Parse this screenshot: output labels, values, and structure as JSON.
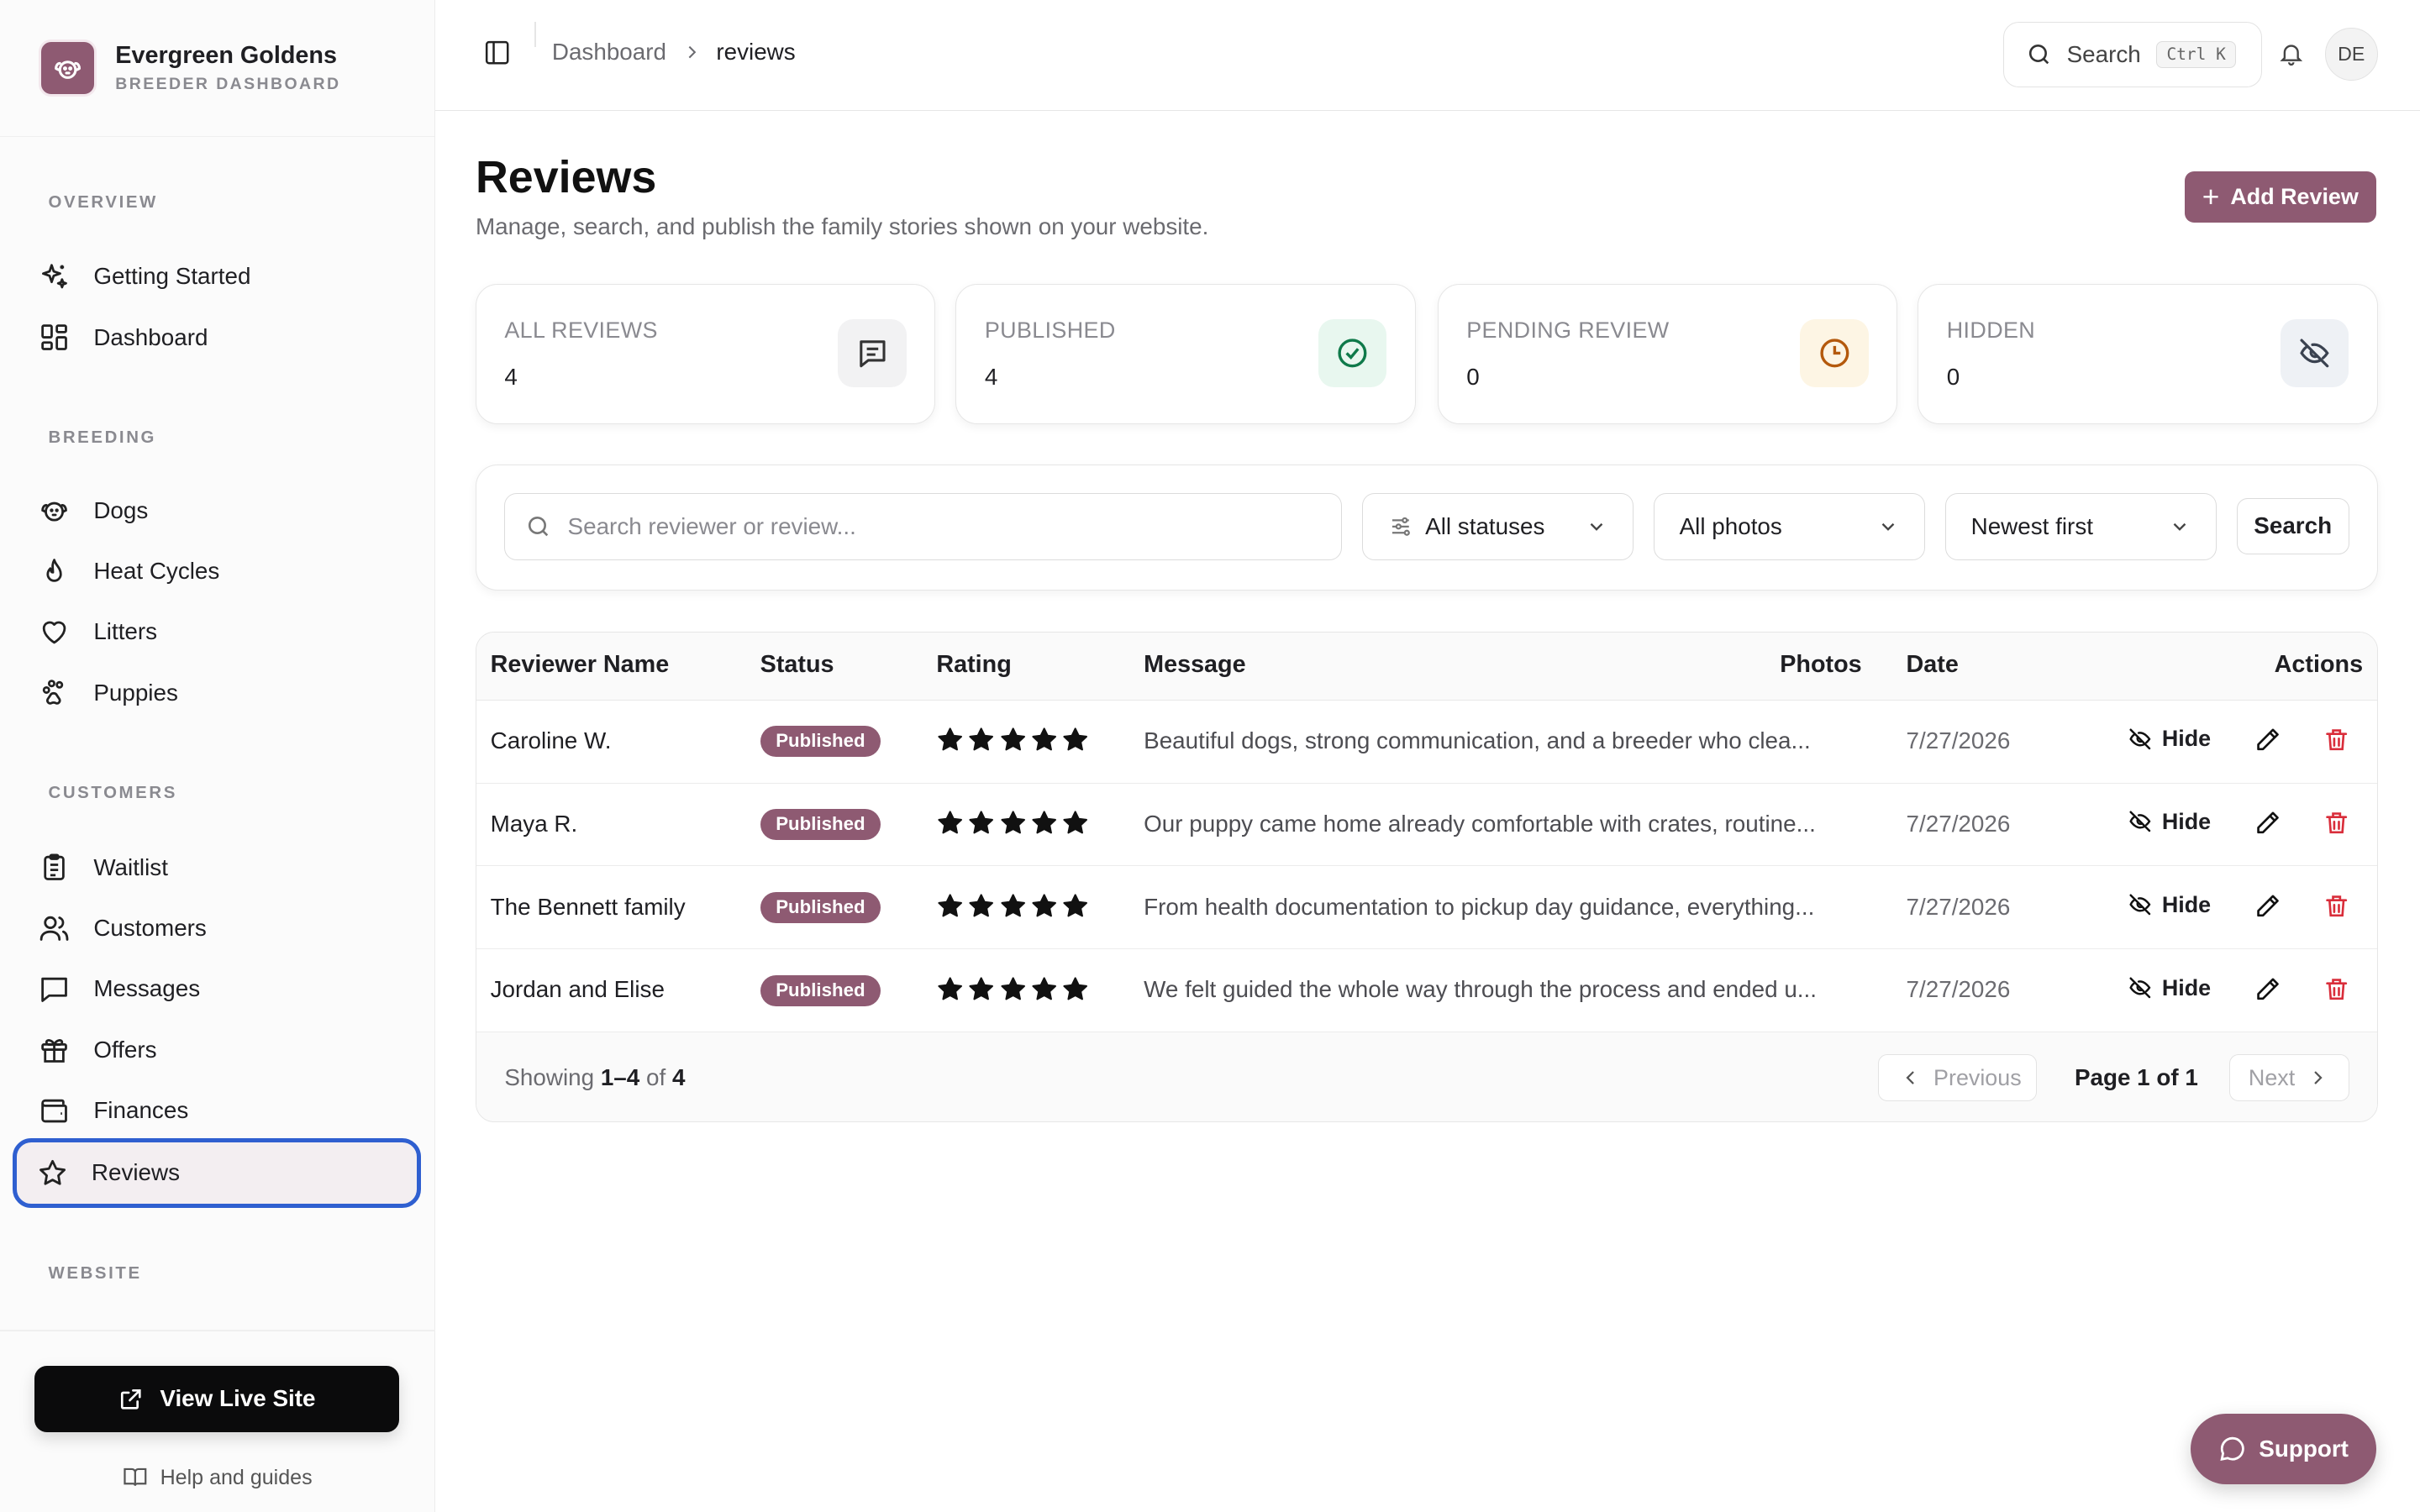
{
  "brand": {
    "name": "Evergreen Goldens",
    "subtitle": "BREEDER DASHBOARD"
  },
  "sidebar": {
    "sections": [
      {
        "label": "OVERVIEW"
      },
      {
        "label": "BREEDING"
      },
      {
        "label": "CUSTOMERS"
      },
      {
        "label": "WEBSITE"
      }
    ],
    "items": [
      {
        "label": "Getting Started",
        "icon": "sparkles-icon"
      },
      {
        "label": "Dashboard",
        "icon": "layout-grid-icon"
      },
      {
        "label": "Dogs",
        "icon": "dog-icon"
      },
      {
        "label": "Heat Cycles",
        "icon": "flame-icon"
      },
      {
        "label": "Litters",
        "icon": "heart-icon"
      },
      {
        "label": "Puppies",
        "icon": "paw-icon"
      },
      {
        "label": "Waitlist",
        "icon": "clipboard-icon"
      },
      {
        "label": "Customers",
        "icon": "users-icon"
      },
      {
        "label": "Messages",
        "icon": "message-icon"
      },
      {
        "label": "Offers",
        "icon": "gift-icon"
      },
      {
        "label": "Finances",
        "icon": "wallet-icon"
      },
      {
        "label": "Reviews",
        "icon": "star-icon",
        "active": true
      }
    ],
    "live_site": "View Live Site",
    "help": "Help and guides"
  },
  "topbar": {
    "breadcrumb": [
      "Dashboard",
      "reviews"
    ],
    "search_label": "Search",
    "search_shortcut": "Ctrl K",
    "avatar": "DE"
  },
  "page": {
    "title": "Reviews",
    "subtitle": "Manage, search, and publish the family stories shown on your website.",
    "add_button": "Add Review"
  },
  "stats": [
    {
      "label": "ALL REVIEWS",
      "value": "4",
      "icon": "message-square-icon",
      "bg": "#f2f2f3",
      "color": "#333333"
    },
    {
      "label": "PUBLISHED",
      "value": "4",
      "icon": "check-circle-icon",
      "bg": "#e8f7ef",
      "color": "#0f7a4a"
    },
    {
      "label": "PENDING REVIEW",
      "value": "0",
      "icon": "clock-icon",
      "bg": "#fdf5e4",
      "color": "#b4590c"
    },
    {
      "label": "HIDDEN",
      "value": "0",
      "icon": "eye-off-icon",
      "bg": "#eef1f5",
      "color": "#3a4250"
    }
  ],
  "filters": {
    "search_placeholder": "Search reviewer or review...",
    "status": "All statuses",
    "photos": "All photos",
    "sort": "Newest first",
    "search_button": "Search"
  },
  "table": {
    "columns": [
      "Reviewer Name",
      "Status",
      "Rating",
      "Message",
      "Photos",
      "Date",
      "Actions"
    ],
    "rows": [
      {
        "name": "Caroline W.",
        "status": "Published",
        "rating": 5,
        "message": "Beautiful dogs, strong communication, and a breeder who clea...",
        "date": "7/27/2026",
        "action": "Hide"
      },
      {
        "name": "Maya R.",
        "status": "Published",
        "rating": 5,
        "message": "Our puppy came home already comfortable with crates, routine...",
        "date": "7/27/2026",
        "action": "Hide"
      },
      {
        "name": "The Bennett family",
        "status": "Published",
        "rating": 5,
        "message": "From health documentation to pickup day guidance, everything...",
        "date": "7/27/2026",
        "action": "Hide"
      },
      {
        "name": "Jordan and Elise",
        "status": "Published",
        "rating": 5,
        "message": "We felt guided the whole way through the process and ended u...",
        "date": "7/27/2026",
        "action": "Hide"
      }
    ],
    "footer": {
      "showing_prefix": "Showing",
      "showing_range": "1–4",
      "showing_of": "of",
      "showing_total": "4",
      "previous": "Previous",
      "page_info": "Page 1 of 1",
      "next": "Next"
    }
  },
  "support": "Support",
  "colors": {
    "accent": "#8e5a72",
    "focus_ring": "#2f5fd0",
    "danger": "#d92d3a"
  }
}
